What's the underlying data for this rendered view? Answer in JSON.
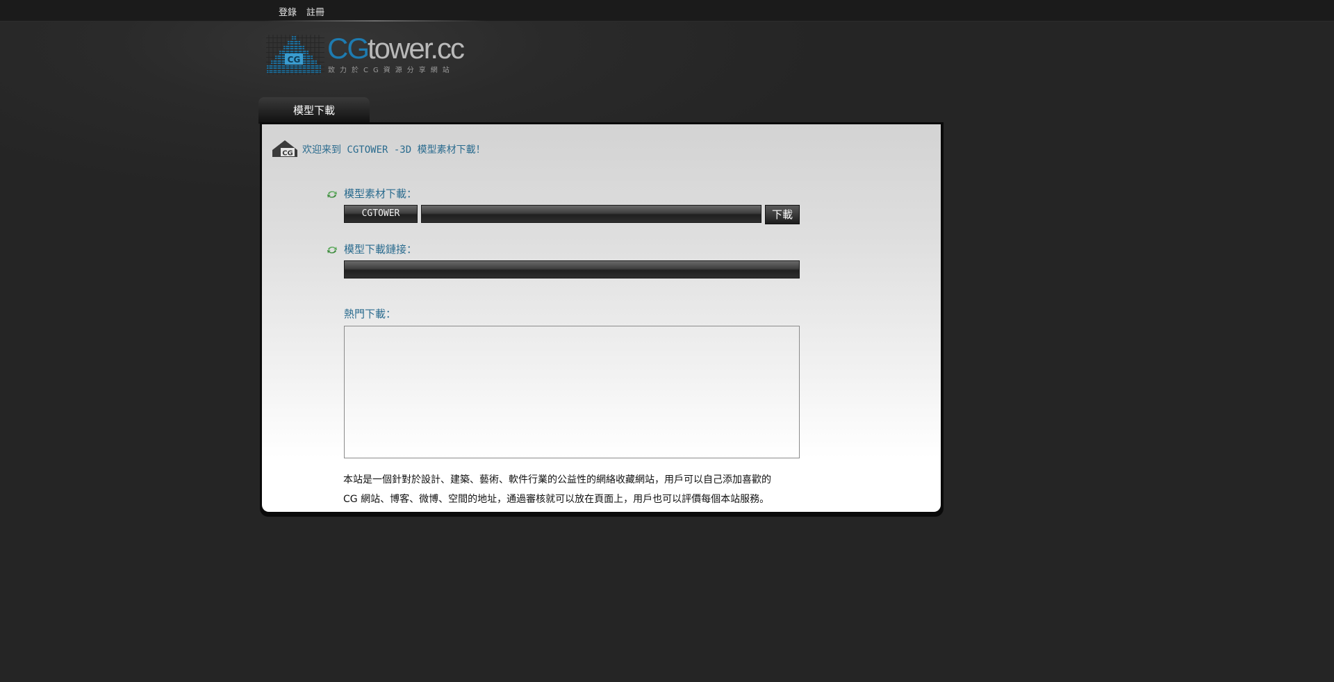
{
  "topbar": {
    "login": "登錄",
    "register": "註冊"
  },
  "logo": {
    "brand_cg": "CG",
    "brand_tower": "tower.cc",
    "slogan": "致力於CG資源分享網站"
  },
  "tab": {
    "label": "模型下載"
  },
  "welcome": {
    "text": "欢迎来到 CGTOWER -3D 模型素材下載！"
  },
  "download_section": {
    "label": "模型素材下載：",
    "source_button": "CGTOWER",
    "input_value": "",
    "download_button": "下載"
  },
  "link_section": {
    "label": "模型下載鏈接：",
    "link_value": ""
  },
  "hot": {
    "label": "熱門下載："
  },
  "description": {
    "line1": "本站是一個針對於設計、建築、藝術、軟件行業的公益性的網絡收藏網站，用戶可以自己添加喜歡的",
    "line2": "CG 網站、博客、微博、空間的地址，通過審核就可以放在頁面上，用戶也可以評價每個本站服務。"
  },
  "colors": {
    "background": "#252525",
    "accent_text": "#2a6b8e",
    "brand_blue": "#1e7bb0"
  }
}
